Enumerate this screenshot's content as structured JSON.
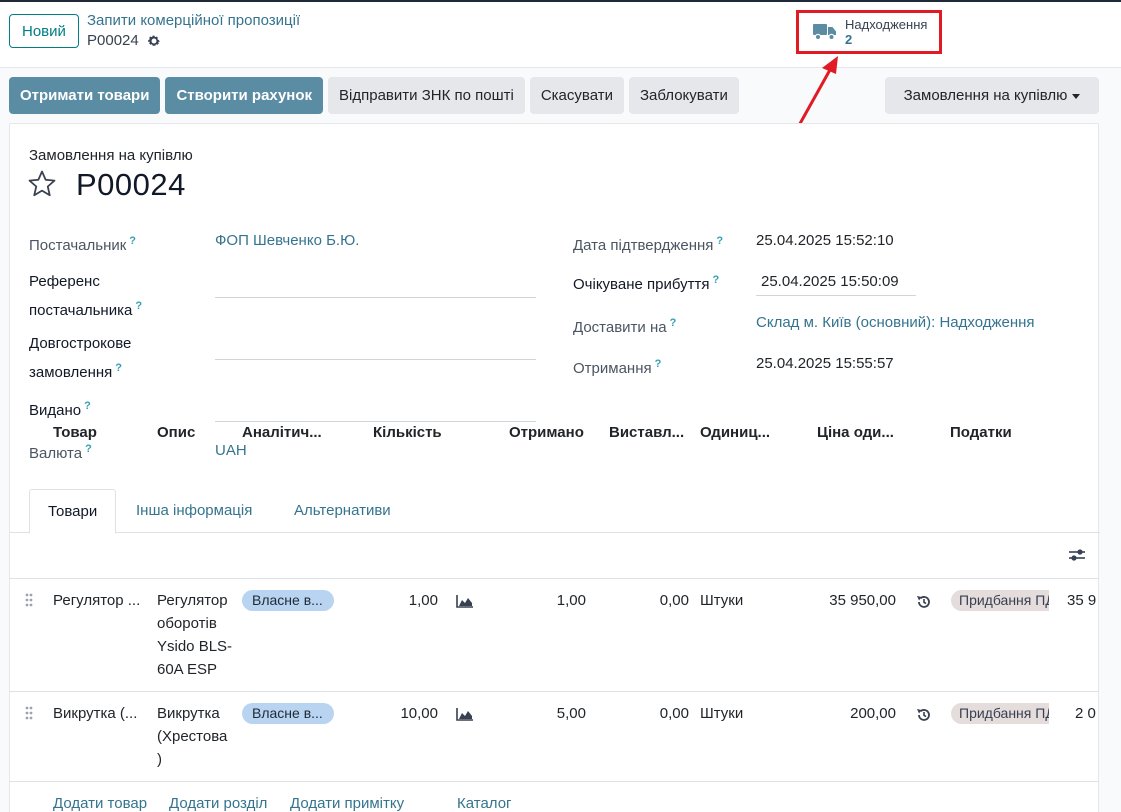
{
  "control_panel": {
    "new_button": "Новий",
    "breadcrumb_parent": "Запити комерційної пропозиції",
    "breadcrumb_current": "P00024",
    "smart_button": {
      "label": "Надходження",
      "value": "2"
    }
  },
  "actions": {
    "receive_products": "Отримати товари",
    "create_bill": "Створити рахунок",
    "send_po_email": "Відправити ЗНК по пошті",
    "cancel": "Скасувати",
    "lock": "Заблокувати",
    "status": "Замовлення на купівлю"
  },
  "sheet": {
    "doc_type": "Замовлення на купівлю",
    "title": "P00024",
    "left_fields": {
      "vendor": {
        "label": "Постачальник",
        "value": "ФОП Шевченко Б.Ю."
      },
      "vendor_ref": {
        "label_line1": "Референс",
        "label_line2": "постачальника",
        "value": ""
      },
      "blanket_order": {
        "label_line1": "Довгострокове",
        "label_line2": "замовлення",
        "value": ""
      },
      "issued_by": {
        "label": "Видано",
        "value": ""
      },
      "currency": {
        "label": "Валюта",
        "value": "UAH"
      }
    },
    "right_fields": {
      "confirmation_date": {
        "label": "Дата підтвердження",
        "value": "25.04.2025 15:52:10"
      },
      "expected_arrival": {
        "label": "Очікуване прибуття",
        "value": "25.04.2025 15:50:09"
      },
      "deliver_to": {
        "label": "Доставити на",
        "value": "Склад м. Київ (основний): Надходження"
      },
      "receipt": {
        "label": "Отримання",
        "value": "25.04.2025 15:55:57"
      }
    },
    "q_mark": "?"
  },
  "tabs": [
    "Товари",
    "Інша інформація",
    "Альтернативи"
  ],
  "table": {
    "headers": [
      "Товар",
      "Опис",
      "Аналітич...",
      "Кількість",
      "Отримано",
      "Виставл...",
      "Одиниц...",
      "Ціна оди...",
      "Податки"
    ],
    "rows": [
      {
        "product": "Регулятор ...",
        "description": [
          "Регулятор",
          "оборотів",
          "Ysido BLS-",
          "60A ESP"
        ],
        "analytic": "Власне в...",
        "quantity": "1,00",
        "received": "1,00",
        "billed": "0,00",
        "uom": "Штуки",
        "price": "35 950,00",
        "tax": "Придбання ПДВ",
        "subtotal": "35 9"
      },
      {
        "product": "Викрутка (...",
        "description": [
          "Викрутка",
          "(Хрестова",
          ")"
        ],
        "analytic": "Власне в...",
        "quantity": "10,00",
        "received": "5,00",
        "billed": "0,00",
        "uom": "Штуки",
        "price": "200,00",
        "tax": "Придбання ПДВ",
        "subtotal": "2 0"
      }
    ],
    "bottom_links": [
      "Додати товар",
      "Додати розділ",
      "Додати примітку",
      "Каталог"
    ]
  },
  "colors": {
    "primary": "#5a8da3",
    "link": "#35748f",
    "highlight": "#e01b24"
  }
}
